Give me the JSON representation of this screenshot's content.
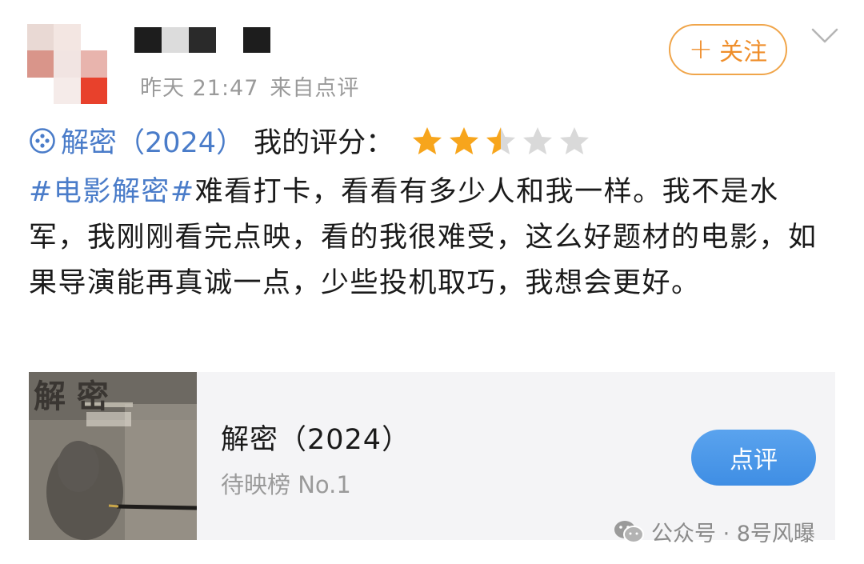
{
  "header": {
    "time": "昨天 21:47",
    "source": "来自点评",
    "follow_label": "关注",
    "follow_plus": "+"
  },
  "rating": {
    "movie_title": "解密（2024）",
    "label": "我的评分：",
    "stars_value": 2.5,
    "stars_max": 5,
    "star_color": "#f7a51c",
    "star_empty_color": "#d9d9d9"
  },
  "post": {
    "hashtag": "#电影解密#",
    "text": "难看打卡，看看有多少人和我一样。我不是水军，我刚刚看完点映，看的我很难受，这么好题材的电影，如果导演能再真诚一点，少些投机取巧，我想会更好。"
  },
  "card": {
    "title": "解密（2024）",
    "subtitle": "待映榜 No.1",
    "button_label": "点评",
    "poster_title": "解 密"
  },
  "watermark": {
    "text": "公众号 · 8号风曝"
  },
  "colors": {
    "link": "#4a7cc9",
    "follow": "#ef8e2a",
    "button": "#3f8ee4"
  }
}
